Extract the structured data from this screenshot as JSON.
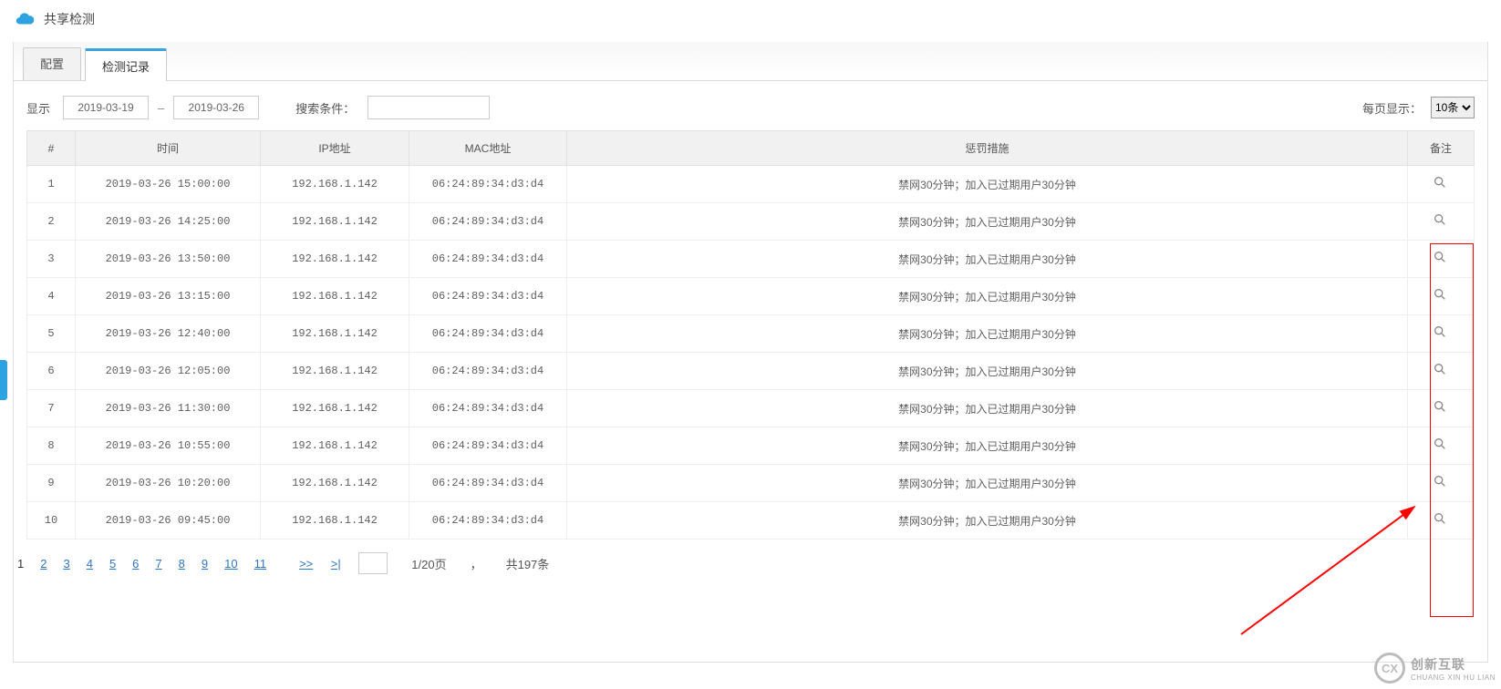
{
  "header": {
    "title": "共享检测"
  },
  "tabs": {
    "config": "配置",
    "records": "检测记录",
    "active_index": 1
  },
  "filter": {
    "show_label": "显示",
    "date_from": "2019-03-19",
    "date_to": "2019-03-26",
    "date_sep": "–",
    "search_label": "搜索条件：",
    "per_page_label": "每页显示：",
    "per_page_selected": "10条"
  },
  "table": {
    "headers": {
      "idx": "#",
      "time": "时间",
      "ip": "IP地址",
      "mac": "MAC地址",
      "punish": "惩罚措施",
      "note": "备注"
    },
    "rows": [
      {
        "idx": "1",
        "time": "2019-03-26 15:00:00",
        "ip": "192.168.1.142",
        "mac": "06:24:89:34:d3:d4",
        "punish": "禁网30分钟；加入已过期用户30分钟"
      },
      {
        "idx": "2",
        "time": "2019-03-26 14:25:00",
        "ip": "192.168.1.142",
        "mac": "06:24:89:34:d3:d4",
        "punish": "禁网30分钟；加入已过期用户30分钟"
      },
      {
        "idx": "3",
        "time": "2019-03-26 13:50:00",
        "ip": "192.168.1.142",
        "mac": "06:24:89:34:d3:d4",
        "punish": "禁网30分钟；加入已过期用户30分钟"
      },
      {
        "idx": "4",
        "time": "2019-03-26 13:15:00",
        "ip": "192.168.1.142",
        "mac": "06:24:89:34:d3:d4",
        "punish": "禁网30分钟；加入已过期用户30分钟"
      },
      {
        "idx": "5",
        "time": "2019-03-26 12:40:00",
        "ip": "192.168.1.142",
        "mac": "06:24:89:34:d3:d4",
        "punish": "禁网30分钟；加入已过期用户30分钟"
      },
      {
        "idx": "6",
        "time": "2019-03-26 12:05:00",
        "ip": "192.168.1.142",
        "mac": "06:24:89:34:d3:d4",
        "punish": "禁网30分钟；加入已过期用户30分钟"
      },
      {
        "idx": "7",
        "time": "2019-03-26 11:30:00",
        "ip": "192.168.1.142",
        "mac": "06:24:89:34:d3:d4",
        "punish": "禁网30分钟；加入已过期用户30分钟"
      },
      {
        "idx": "8",
        "time": "2019-03-26 10:55:00",
        "ip": "192.168.1.142",
        "mac": "06:24:89:34:d3:d4",
        "punish": "禁网30分钟；加入已过期用户30分钟"
      },
      {
        "idx": "9",
        "time": "2019-03-26 10:20:00",
        "ip": "192.168.1.142",
        "mac": "06:24:89:34:d3:d4",
        "punish": "禁网30分钟；加入已过期用户30分钟"
      },
      {
        "idx": "10",
        "time": "2019-03-26 09:45:00",
        "ip": "192.168.1.142",
        "mac": "06:24:89:34:d3:d4",
        "punish": "禁网30分钟；加入已过期用户30分钟"
      }
    ]
  },
  "pager": {
    "current": "1",
    "pages": [
      "2",
      "3",
      "4",
      "5",
      "6",
      "7",
      "8",
      "9",
      "10",
      "11"
    ],
    "next": ">>",
    "last": ">|",
    "info_pages": "1/20页",
    "info_sep": "，",
    "info_total": "共197条"
  },
  "brand": {
    "text": "创新互联",
    "sub": "CHUANG XIN HU LIAN"
  }
}
